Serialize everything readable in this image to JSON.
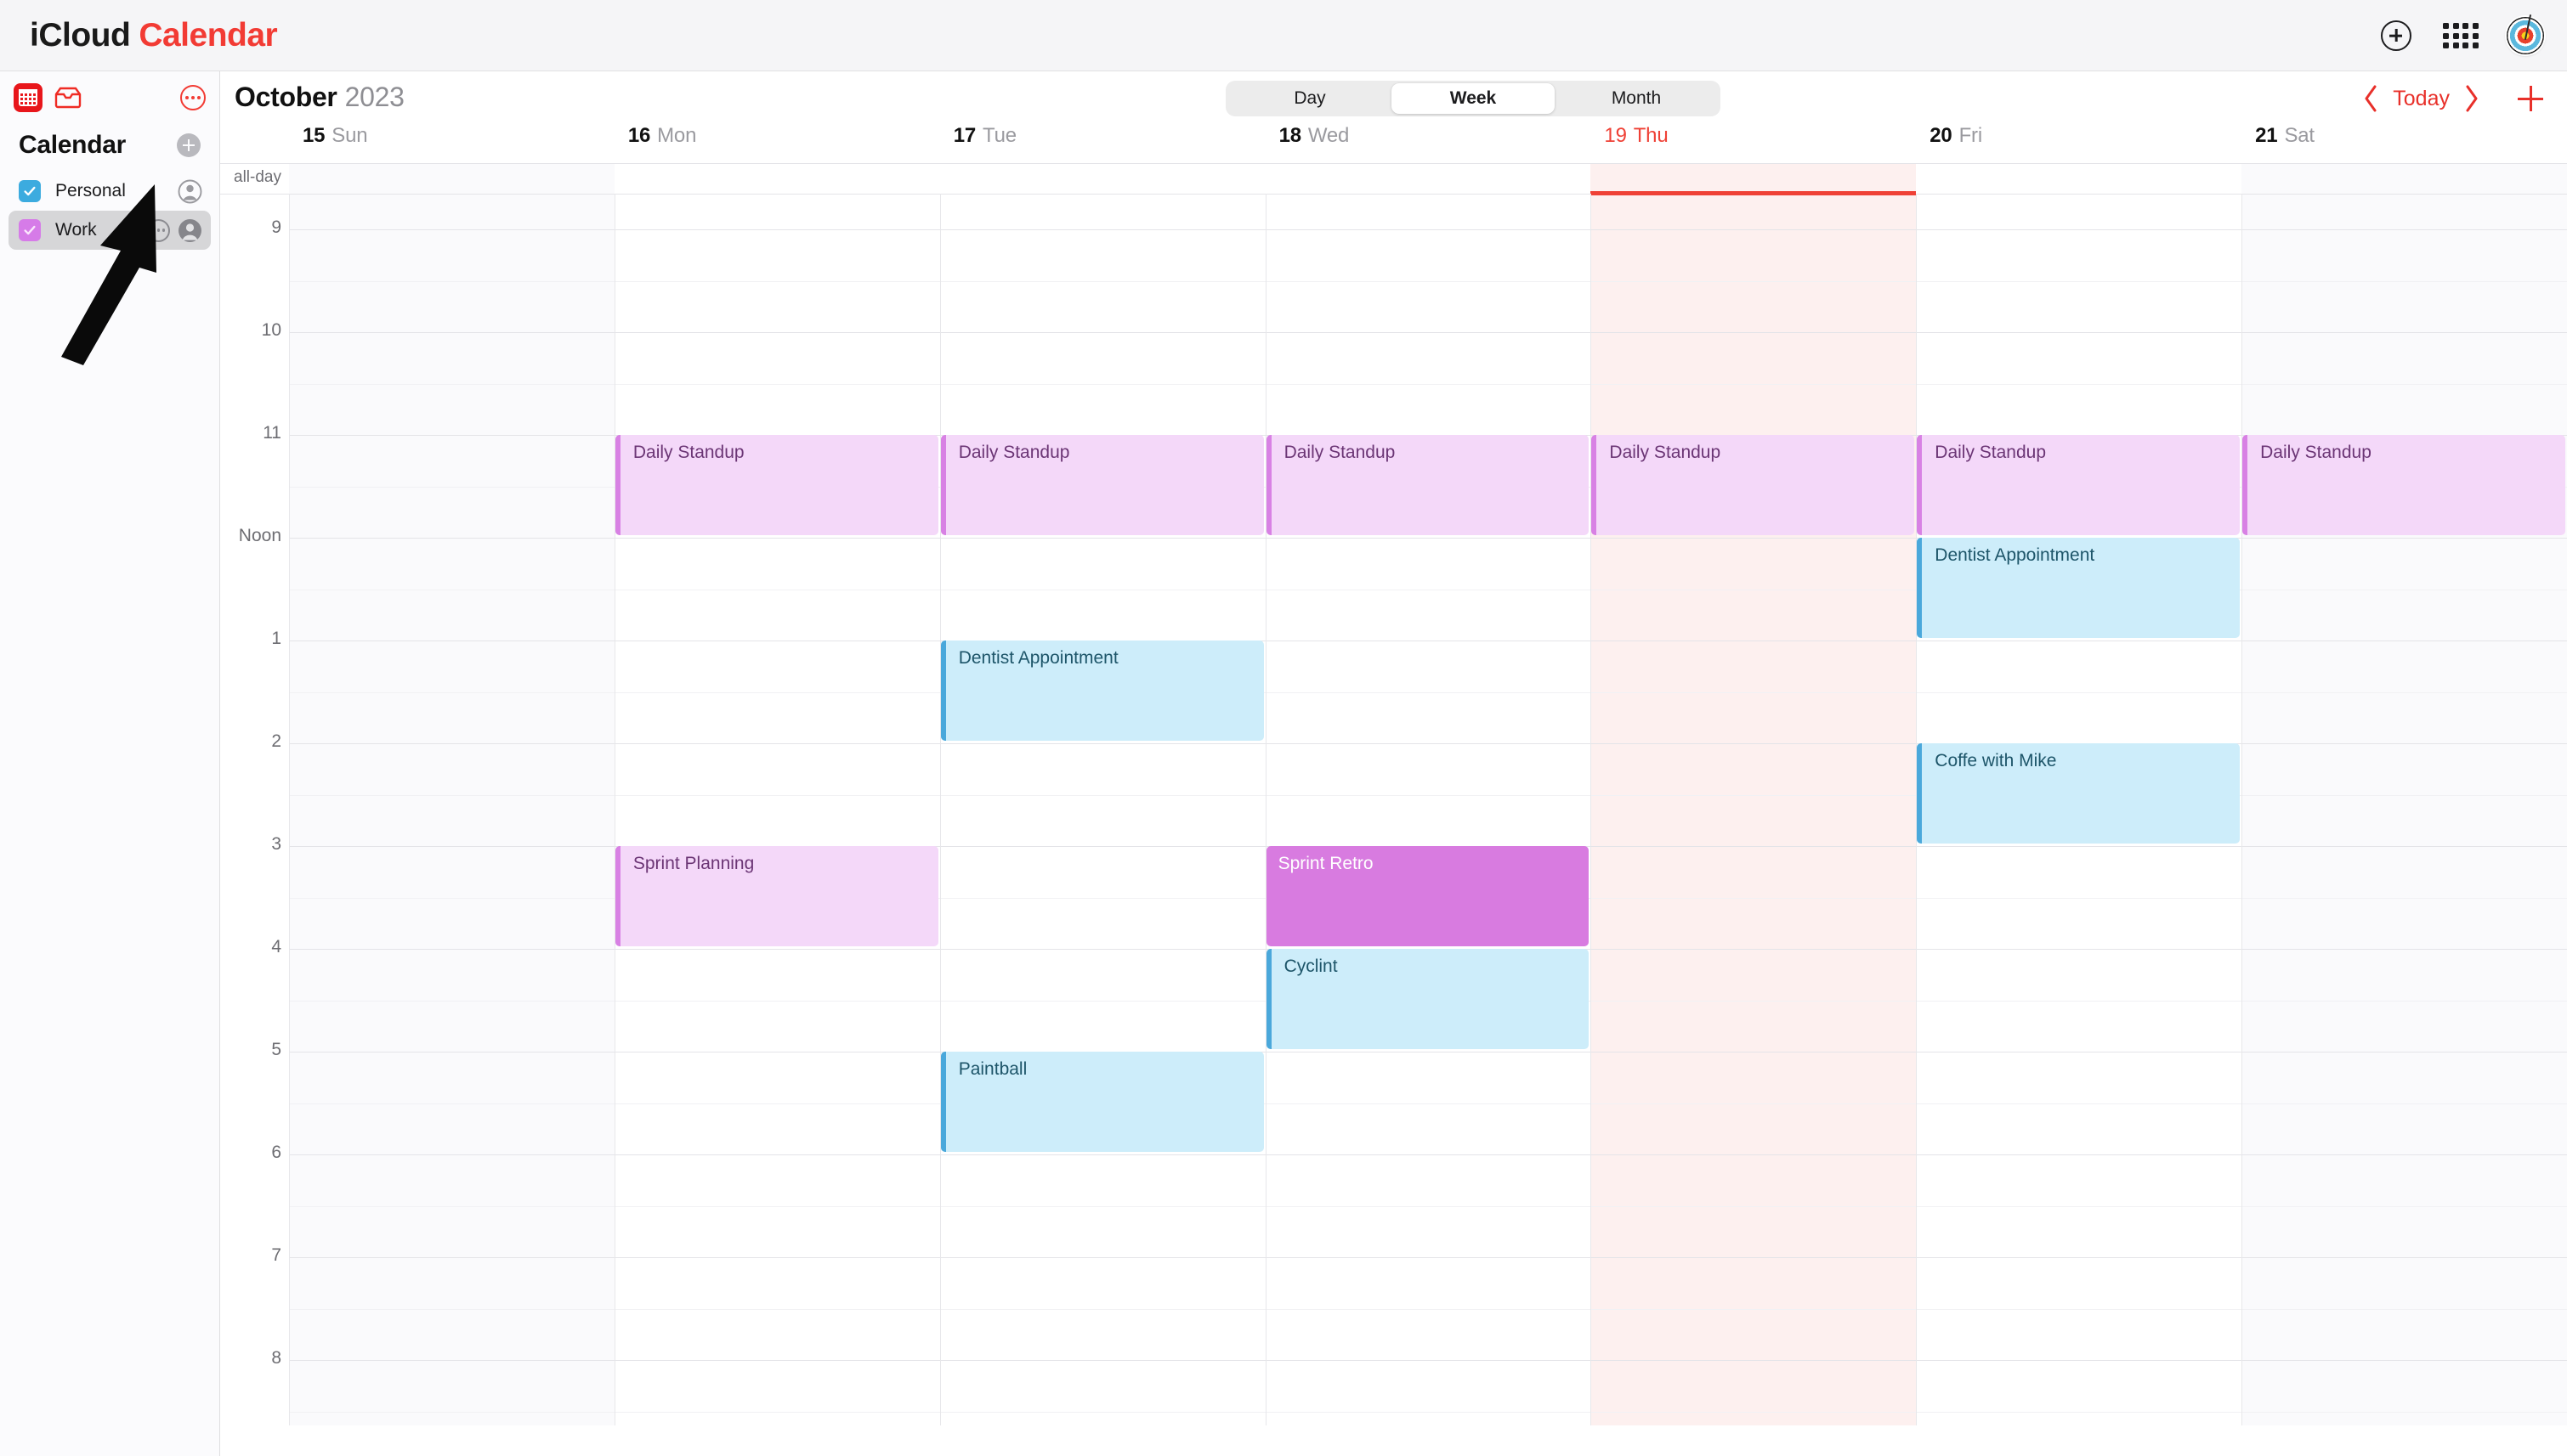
{
  "topbar": {
    "apple_glyph": "",
    "brand_icloud": "iCloud",
    "brand_app": "Calendar",
    "icons": [
      "plus-circle-icon",
      "app-grid-icon",
      "account-avatar"
    ]
  },
  "sidebar": {
    "app_icon": "calendar-app-icon",
    "inbox_icon": "inbox-icon",
    "more_icon": "more-options-icon",
    "title": "Calendar",
    "add_calendar_label": "+",
    "calendars": [
      {
        "label": "Personal",
        "checked": true,
        "color": "#3cabdf",
        "selected": false,
        "has_more": false
      },
      {
        "label": "Work",
        "checked": true,
        "color": "#d67be8",
        "selected": true,
        "has_more": true
      }
    ]
  },
  "toolbar": {
    "month": "October",
    "year": "2023",
    "views": [
      {
        "label": "Day",
        "active": false
      },
      {
        "label": "Week",
        "active": true
      },
      {
        "label": "Month",
        "active": false
      }
    ],
    "prev_label": "‹",
    "today_label": "Today",
    "next_label": "›",
    "add_event_label": "+"
  },
  "calendar": {
    "allday_label": "all-day",
    "days": [
      {
        "num": "15",
        "dow": "Sun",
        "today": false,
        "weekend": true
      },
      {
        "num": "16",
        "dow": "Mon",
        "today": false,
        "weekend": false
      },
      {
        "num": "17",
        "dow": "Tue",
        "today": false,
        "weekend": false
      },
      {
        "num": "18",
        "dow": "Wed",
        "today": false,
        "weekend": false
      },
      {
        "num": "19",
        "dow": "Thu",
        "today": true,
        "weekend": false
      },
      {
        "num": "20",
        "dow": "Fri",
        "today": false,
        "weekend": false
      },
      {
        "num": "21",
        "dow": "Sat",
        "today": false,
        "weekend": true
      }
    ],
    "hours": [
      "9",
      "10",
      "11",
      "Noon",
      "1",
      "2",
      "3",
      "4",
      "5",
      "6",
      "7",
      "8"
    ],
    "today_color": "#ef4136",
    "events": [
      {
        "title": "Daily Standup",
        "day": 1,
        "start_hour": "11",
        "duration": 1,
        "color": "purple",
        "selected": false
      },
      {
        "title": "Daily Standup",
        "day": 2,
        "start_hour": "11",
        "duration": 1,
        "color": "purple",
        "selected": false
      },
      {
        "title": "Daily Standup",
        "day": 3,
        "start_hour": "11",
        "duration": 1,
        "color": "purple",
        "selected": false
      },
      {
        "title": "Daily Standup",
        "day": 4,
        "start_hour": "11",
        "duration": 1,
        "color": "purple",
        "selected": false
      },
      {
        "title": "Daily Standup",
        "day": 5,
        "start_hour": "11",
        "duration": 1,
        "color": "purple",
        "selected": false
      },
      {
        "title": "Daily Standup",
        "day": 6,
        "start_hour": "11",
        "duration": 1,
        "color": "purple",
        "selected": false
      },
      {
        "title": "Dentist Appointment",
        "day": 5,
        "start_hour": "Noon",
        "duration": 1,
        "color": "blue",
        "selected": false
      },
      {
        "title": "Dentist Appointment",
        "day": 2,
        "start_hour": "1",
        "duration": 1,
        "color": "blue",
        "selected": false
      },
      {
        "title": "Coffe with Mike",
        "day": 5,
        "start_hour": "2",
        "duration": 1,
        "color": "blue",
        "selected": false
      },
      {
        "title": "Sprint Planning",
        "day": 1,
        "start_hour": "3",
        "duration": 1,
        "color": "purple",
        "selected": false
      },
      {
        "title": "Sprint Retro",
        "day": 3,
        "start_hour": "3",
        "duration": 1,
        "color": "purple",
        "selected": true
      },
      {
        "title": "Cyclint",
        "day": 3,
        "start_hour": "4",
        "duration": 1,
        "color": "blue",
        "selected": false
      },
      {
        "title": "Paintball",
        "day": 2,
        "start_hour": "5",
        "duration": 1,
        "color": "blue",
        "selected": false
      }
    ]
  },
  "annotation": {
    "arrow": "pointer-arrow-up-right"
  }
}
